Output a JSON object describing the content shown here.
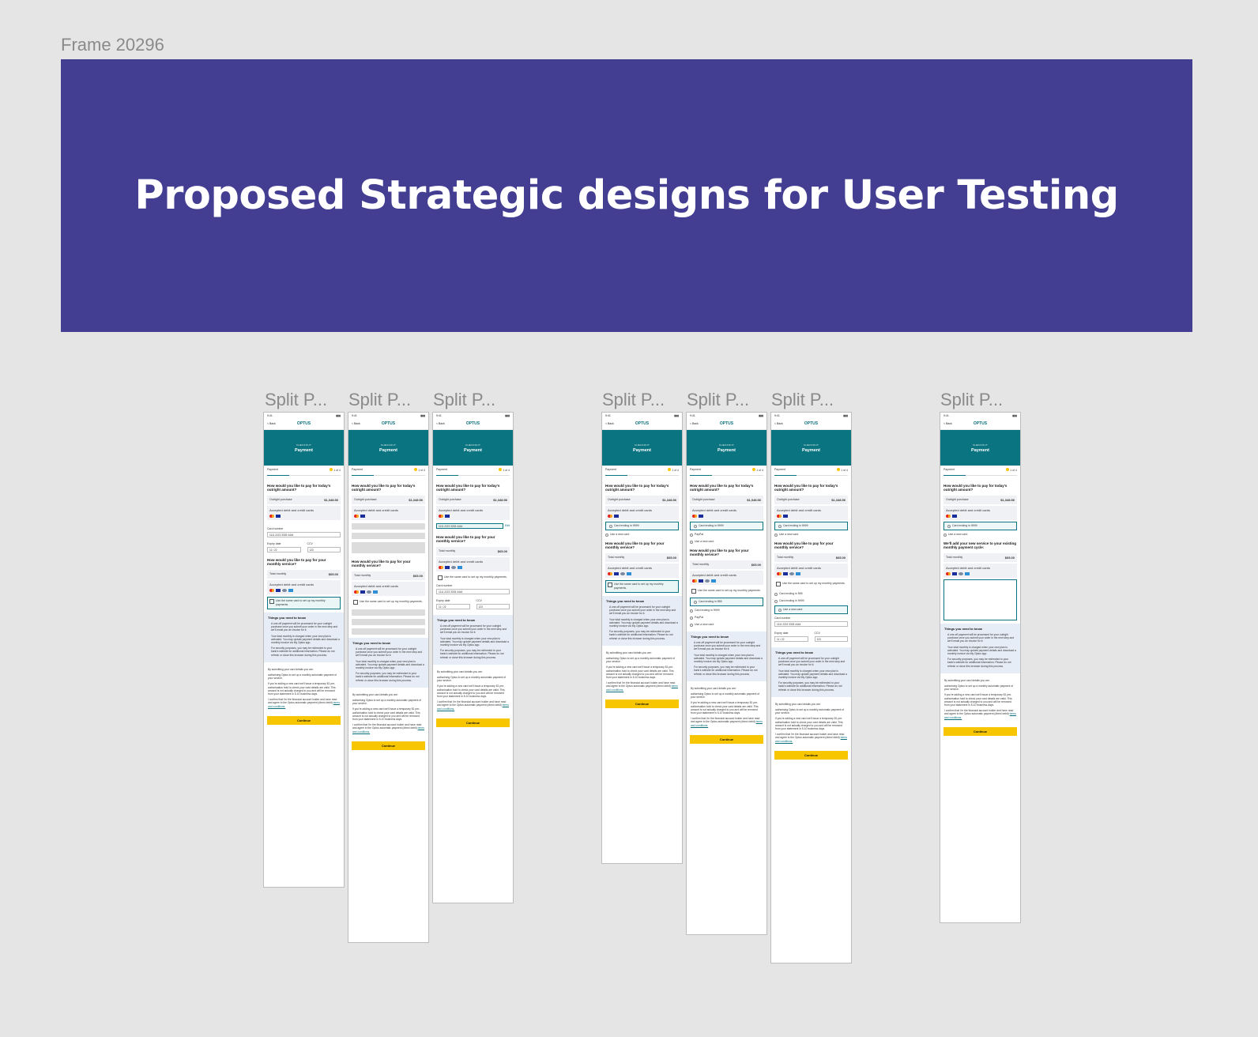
{
  "frame_label": "Frame 20296",
  "banner": {
    "title": "Proposed Strategic designs for User Testing"
  },
  "phone_label": "Split P...",
  "common": {
    "time": "9:41",
    "back": "< Back",
    "brand": "OPTUS",
    "kicker": "CHECKOUT",
    "page_title": "Payment",
    "step_label": "Payment",
    "step_count": "1 of 4",
    "q_outright": "How would you like to pay for today's outright amount?",
    "outright_label": "Outright purchase",
    "outright_amount": "$1,348.56",
    "accepted": "Accepted debit and credit cards",
    "q_monthly": "How would you like to pay for your monthly service?",
    "q_existing": "We'll add your new service to your existing monthly payment cycle:",
    "total_monthly": "Total monthly",
    "monthly_amount": "$65.00",
    "card_number": "Card number",
    "card_value": "1111 2222 3333 4444",
    "expiry": "Expiry date",
    "expiry_value": "11 / 22",
    "ccv": "CCV",
    "ccv_value": "123",
    "same_card": "Use the same card to set up my monthly payments.",
    "card_9999": "Card ending in 9999",
    "card_555": "Card ending in 555",
    "paypal": "PayPal",
    "new_card": "Use a new card",
    "edit": "Edit",
    "know_title": "Things you need to know",
    "know_1": "A one-off payment will be processed for your outright purchase once you submit your order in the next step and we'll email you an invoice for it.",
    "know_2": "Your total monthly is charged when your new plan is activated. You may update payment details and download a monthly invoice via My Optus app.",
    "know_3": "For security purposes, you may be redirected to your bank's website for additional information. Please do not refresh or close this browser during this process.",
    "legal_1": "By submitting your card details you are:",
    "legal_2": "authorising Optus to set up a monthly automatic payment of your service.",
    "legal_3": "If you're adding a new card we'll issue a temporary $1 pre-authorisation hold to check your card details are valid. This amount is not actually charged to you and will be removed from your statement in 5-10 business days.",
    "legal_4": "I confirm that I'm the financial account holder and have read and agree to the Optus automatic payment (direct debit)",
    "terms": "terms and conditions.",
    "continue": "Continue"
  }
}
